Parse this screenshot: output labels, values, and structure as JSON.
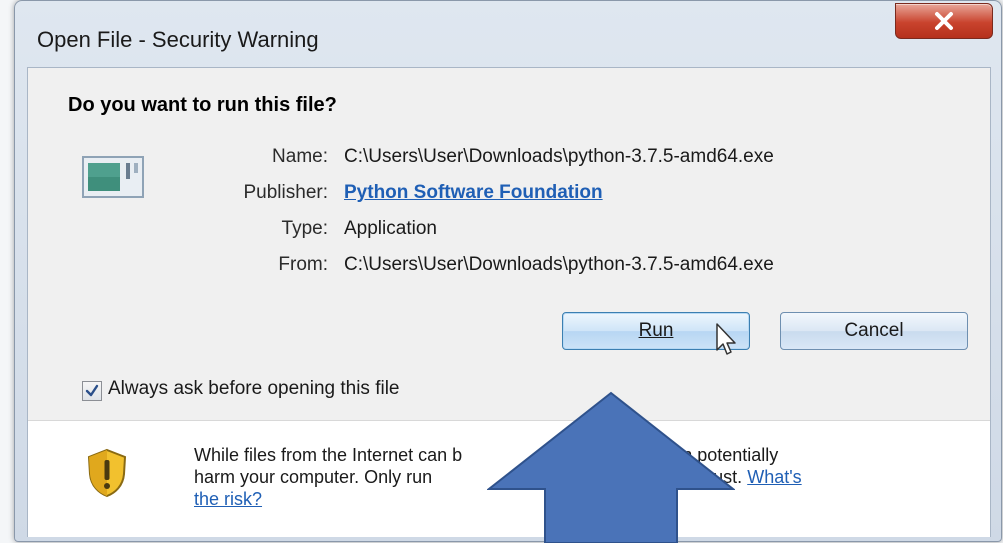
{
  "window": {
    "title": "Open File - Security Warning"
  },
  "dialog": {
    "question": "Do you want to run this file?",
    "fields": [
      {
        "label": "Name:",
        "value": "C:\\Users\\User\\Downloads\\python-3.7.5-amd64.exe"
      },
      {
        "label": "Publisher:",
        "value": "Python Software Foundation"
      },
      {
        "label": "Type:",
        "value": "Application"
      },
      {
        "label": "From:",
        "value": "C:\\Users\\User\\Downloads\\python-3.7.5-amd64.exe"
      }
    ],
    "buttons": {
      "run_label": "Run",
      "cancel_label": "Cancel"
    },
    "checkbox": {
      "label": "Always ask before opening this file",
      "checked": true
    },
    "warning": {
      "text_part1": "While files from the Internet can b",
      "text_part2": "type can potentially",
      "text_part3": "harm your computer. Only run",
      "text_part4": "ers you trust.",
      "link_text_1": "What's",
      "link_text_2": "the risk?"
    }
  },
  "icons": {
    "close": "close-icon",
    "file": "application-file-icon",
    "shield": "shield-warning-icon",
    "cursor": "mouse-pointer-icon",
    "overlay_arrow": "up-arrow-overlay"
  },
  "colors": {
    "close_button": "#c9432d",
    "link": "#1f5fb5",
    "overlay_arrow": "#4a73b8",
    "shield_yellow": "#f2c12e"
  }
}
